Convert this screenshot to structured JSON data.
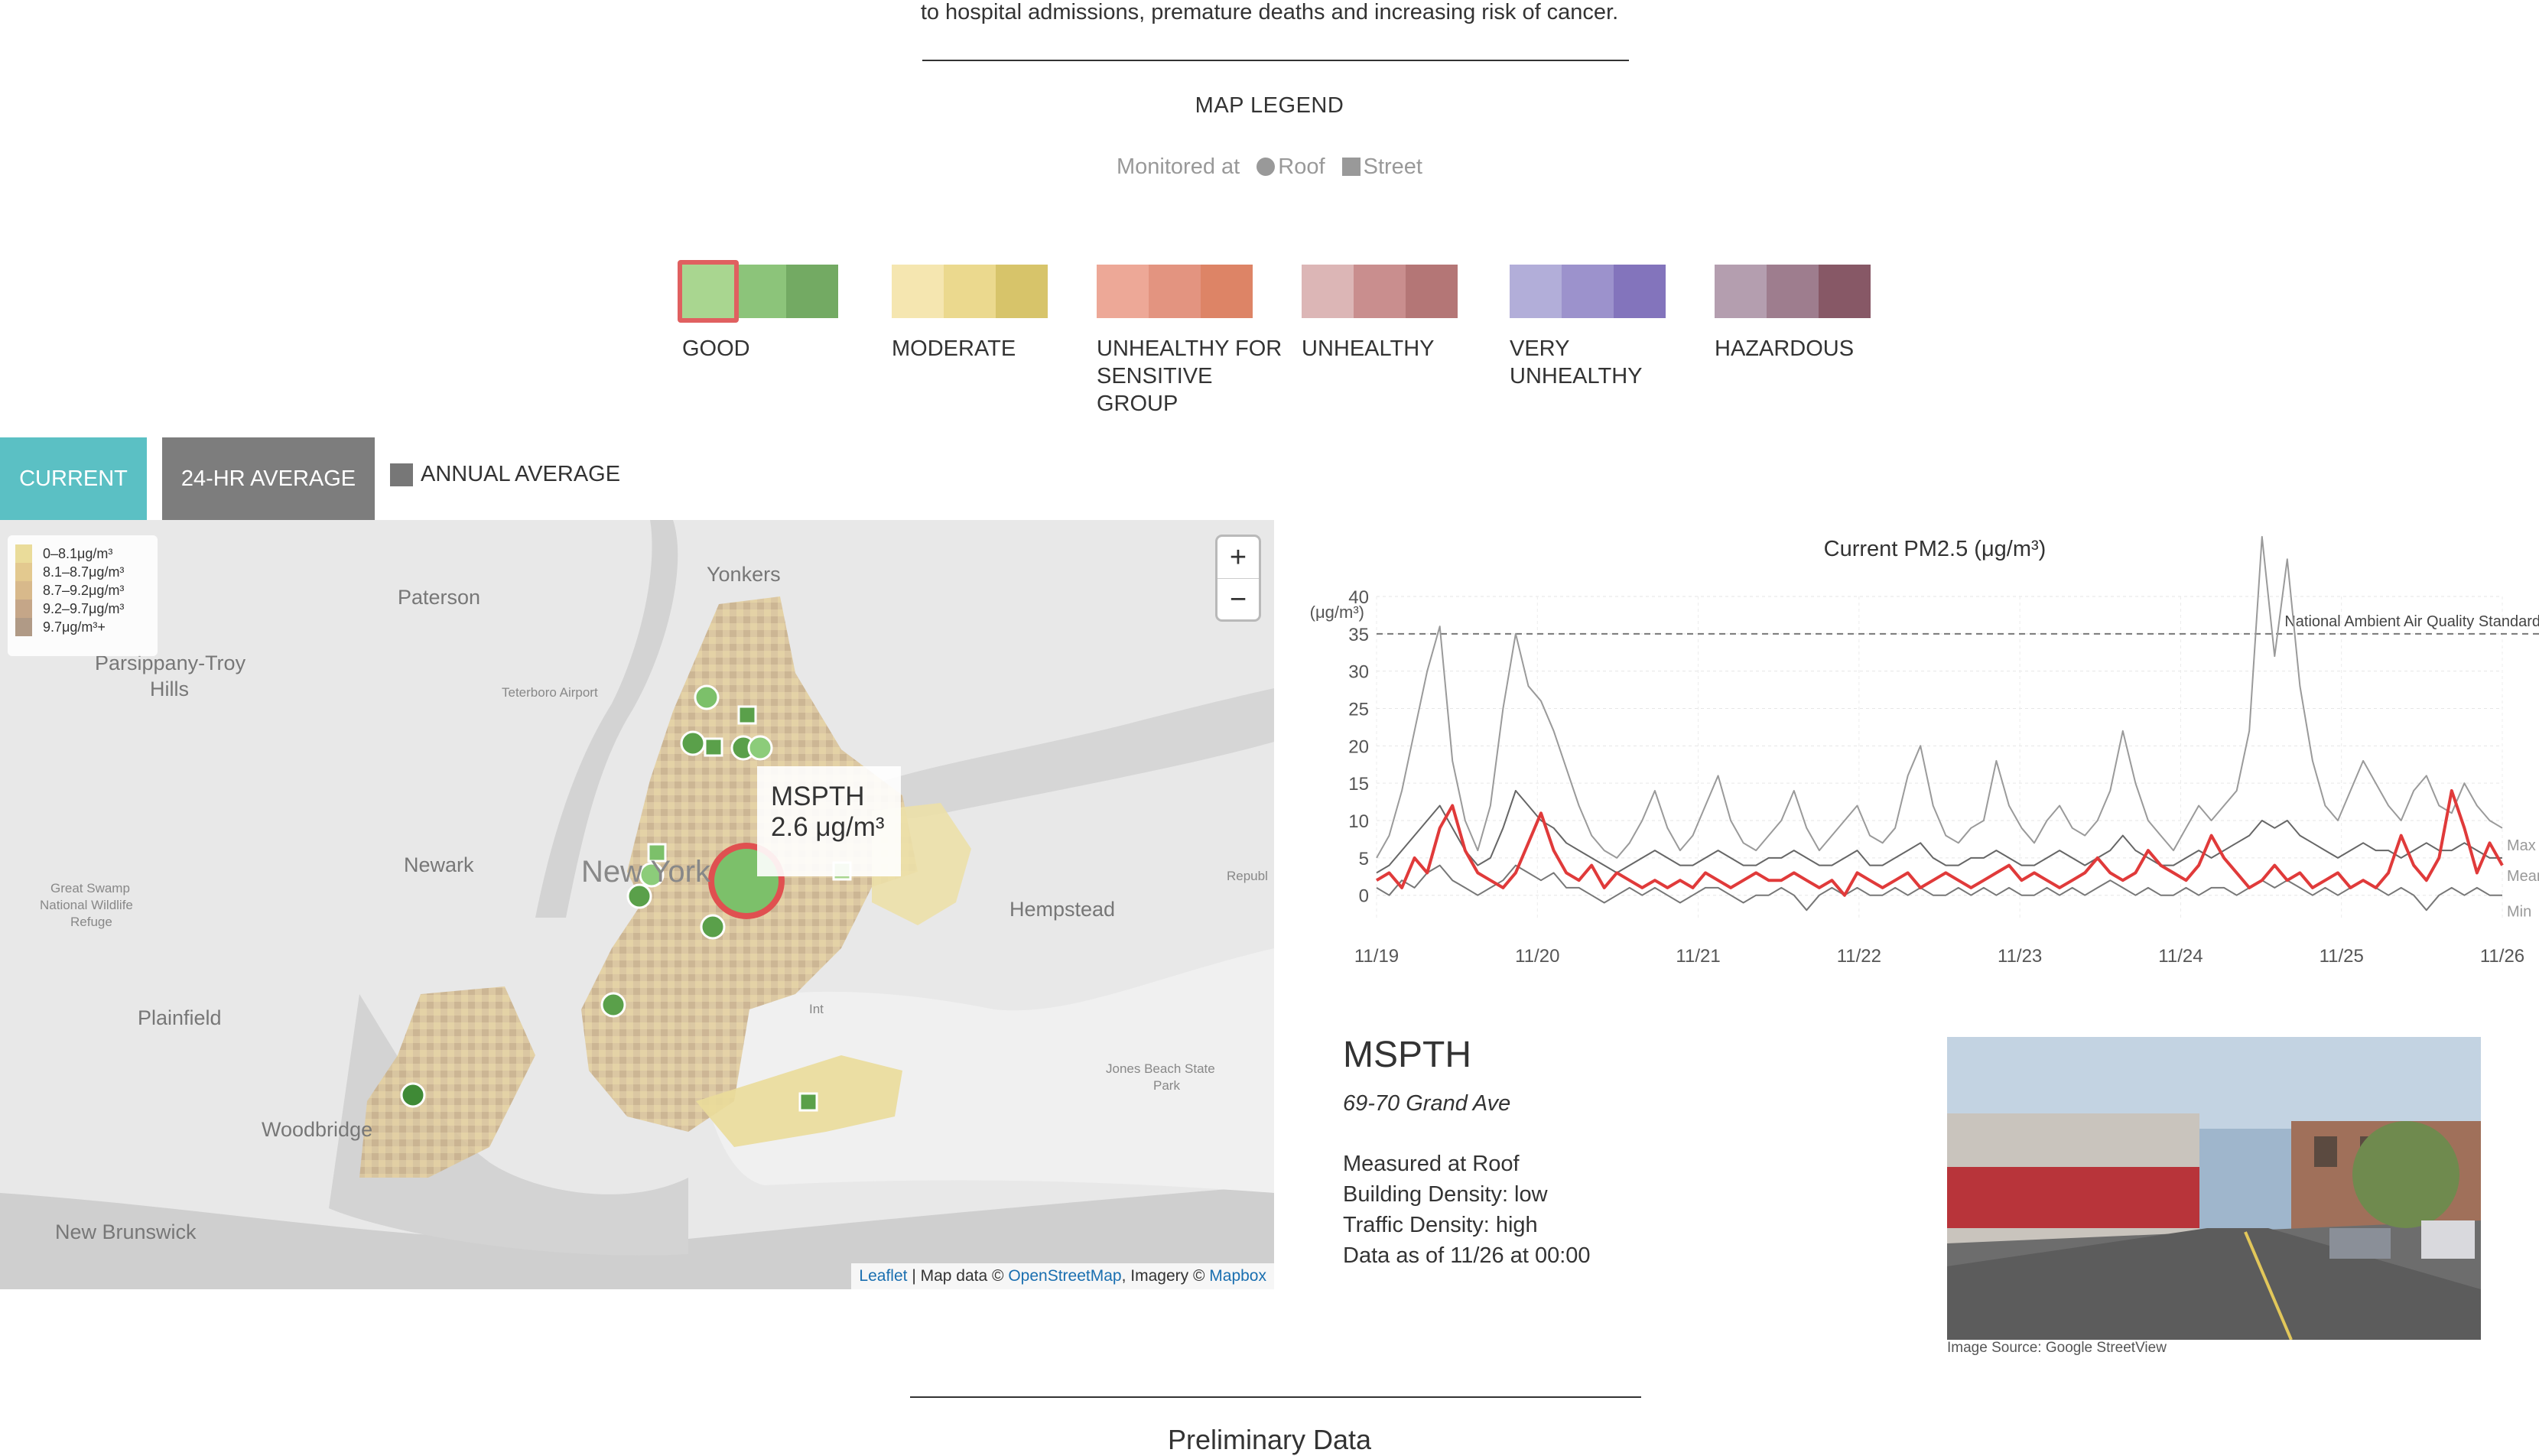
{
  "intro_text": "to hospital admissions, premature deaths and increasing risk of cancer.",
  "map_legend": {
    "title": "MAP LEGEND",
    "monitored_at": "Monitored at",
    "roof": "Roof",
    "street": "Street"
  },
  "aqi_categories": [
    {
      "label": "GOOD",
      "colors": [
        "#a9d690",
        "#8cc47a",
        "#73aa63"
      ]
    },
    {
      "label": "MODERATE",
      "colors": [
        "#f5e6b0",
        "#ebd98e",
        "#d7c46a"
      ]
    },
    {
      "label": "UNHEALTHY FOR SENSITIVE GROUP",
      "colors": [
        "#eda897",
        "#e39480",
        "#dd8466"
      ]
    },
    {
      "label": "UNHEALTHY",
      "colors": [
        "#dcb6b6",
        "#c98e8e",
        "#b47676"
      ]
    },
    {
      "label": "VERY UNHEALTHY",
      "colors": [
        "#b2aed9",
        "#9c92cc",
        "#8374bc"
      ]
    },
    {
      "label": "HAZARDOUS",
      "colors": [
        "#b49eaf",
        "#9e7d8e",
        "#875866"
      ]
    }
  ],
  "tabs": {
    "current": "CURRENT",
    "avg24": "24-HR AVERAGE",
    "annual": "ANNUAL AVERAGE"
  },
  "map": {
    "legend_items": [
      {
        "label": "0–8.1μg/m³",
        "color": "#eadc9a"
      },
      {
        "label": "8.1–8.7μg/m³",
        "color": "#e3c98f"
      },
      {
        "label": "8.7–9.2μg/m³",
        "color": "#d8b98b"
      },
      {
        "label": "9.2–9.7μg/m³",
        "color": "#c5a688"
      },
      {
        "label": "9.7μg/m³+",
        "color": "#b09a86"
      }
    ],
    "zoom_in": "+",
    "zoom_out": "−",
    "places": {
      "yonkers": "Yonkers",
      "paterson": "Paterson",
      "parsippany": "Parsippany-Troy",
      "hills": "Hills",
      "teterboro": "Teterboro Airport",
      "newark": "Newark",
      "newyork": "New York",
      "hempstead": "Hempstead",
      "republic": "Republ",
      "plainfield": "Plainfield",
      "woodbridge": "Woodbridge",
      "new_brunswick": "New Brunswick",
      "great_swamp_1": "Great Swamp",
      "great_swamp_2": "National Wildlife",
      "great_swamp_3": "Refuge",
      "jones_beach_1": "Jones Beach State",
      "jones_beach_2": "Park",
      "int": "Int"
    },
    "tooltip": {
      "station": "MSPTH",
      "value": "2.6 μg/m³"
    },
    "attribution": {
      "leaflet": "Leaflet",
      "map_data": "Map data ©",
      "osm": "OpenStreetMap",
      "imagery": "Imagery ©",
      "mapbox": "Mapbox"
    }
  },
  "chart_data": {
    "type": "line",
    "title": "Current PM2.5 (μg/m³)",
    "ylabel": "(μg/m³)",
    "ylim": [
      -3,
      40
    ],
    "yticks": [
      0,
      5,
      10,
      15,
      20,
      25,
      30,
      35,
      40
    ],
    "xticks": [
      "11/19",
      "11/20",
      "11/21",
      "11/22",
      "11/23",
      "11/24",
      "11/25",
      "11/26"
    ],
    "reference_line": {
      "value": 35,
      "label": "National Ambient Air Quality Standard"
    },
    "stat_labels": [
      "Max",
      "Mean",
      "Min"
    ],
    "series": [
      {
        "name": "MSPTH",
        "color": "#e03a3a",
        "values": [
          2,
          3,
          1,
          5,
          3,
          9,
          12,
          6,
          3,
          2,
          1,
          3,
          7,
          11,
          6,
          3,
          2,
          4,
          1,
          3,
          2,
          1,
          2,
          1,
          2,
          1,
          3,
          2,
          1,
          2,
          3,
          2,
          2,
          3,
          2,
          1,
          2,
          0,
          3,
          2,
          1,
          2,
          3,
          1,
          2,
          3,
          2,
          1,
          2,
          3,
          4,
          2,
          3,
          2,
          1,
          2,
          3,
          5,
          3,
          2,
          3,
          6,
          4,
          3,
          2,
          4,
          8,
          5,
          3,
          1,
          2,
          4,
          2,
          3,
          1,
          2,
          3,
          1,
          2,
          1,
          3,
          8,
          4,
          2,
          5,
          14,
          9,
          3,
          7,
          4
        ]
      },
      {
        "name": "Max",
        "color": "#9a9a9a",
        "values": [
          5,
          8,
          14,
          22,
          30,
          36,
          18,
          10,
          6,
          12,
          25,
          35,
          28,
          26,
          22,
          17,
          12,
          8,
          6,
          5,
          7,
          10,
          14,
          9,
          6,
          8,
          12,
          16,
          10,
          7,
          6,
          8,
          10,
          14,
          9,
          6,
          8,
          10,
          12,
          8,
          7,
          9,
          16,
          20,
          12,
          8,
          7,
          9,
          10,
          18,
          12,
          9,
          7,
          10,
          12,
          9,
          8,
          10,
          14,
          22,
          15,
          10,
          8,
          6,
          9,
          12,
          10,
          12,
          14,
          22,
          48,
          32,
          45,
          28,
          18,
          12,
          10,
          14,
          18,
          15,
          12,
          10,
          14,
          16,
          12,
          11,
          15,
          12,
          10,
          9
        ]
      },
      {
        "name": "Mean",
        "color": "#666666",
        "values": [
          3,
          4,
          6,
          8,
          10,
          12,
          9,
          6,
          4,
          5,
          9,
          14,
          12,
          10,
          9,
          7,
          6,
          5,
          4,
          3,
          4,
          5,
          6,
          5,
          4,
          4,
          5,
          6,
          5,
          4,
          4,
          5,
          5,
          6,
          5,
          4,
          4,
          5,
          6,
          4,
          4,
          5,
          6,
          7,
          5,
          4,
          4,
          5,
          5,
          6,
          5,
          4,
          4,
          5,
          6,
          5,
          4,
          5,
          6,
          8,
          6,
          5,
          4,
          4,
          5,
          6,
          5,
          6,
          7,
          8,
          10,
          9,
          10,
          8,
          7,
          6,
          5,
          6,
          7,
          6,
          6,
          5,
          6,
          7,
          6,
          6,
          7,
          6,
          5,
          5
        ]
      },
      {
        "name": "Min",
        "color": "#777777",
        "values": [
          1,
          0,
          2,
          1,
          3,
          4,
          2,
          1,
          0,
          1,
          2,
          4,
          3,
          2,
          3,
          1,
          1,
          0,
          -1,
          0,
          1,
          0,
          1,
          0,
          -1,
          0,
          1,
          1,
          0,
          -1,
          0,
          0,
          1,
          0,
          -2,
          0,
          1,
          0,
          1,
          0,
          0,
          1,
          0,
          1,
          0,
          0,
          1,
          0,
          1,
          0,
          1,
          0,
          0,
          1,
          0,
          1,
          0,
          1,
          2,
          1,
          0,
          1,
          0,
          0,
          1,
          0,
          1,
          1,
          0,
          1,
          2,
          1,
          2,
          1,
          0,
          1,
          0,
          1,
          2,
          1,
          0,
          1,
          0,
          -2,
          0,
          1,
          0,
          1,
          0,
          0
        ]
      }
    ]
  },
  "station": {
    "name": "MSPTH",
    "address": "69-70 Grand Ave",
    "measured_at": "Measured at Roof",
    "building_density": "Building Density: low",
    "traffic_density": "Traffic Density: high",
    "data_as_of": "Data as of 11/26 at 00:00",
    "image_source": "Image Source: Google StreetView"
  },
  "section_heading": "Preliminary Data"
}
